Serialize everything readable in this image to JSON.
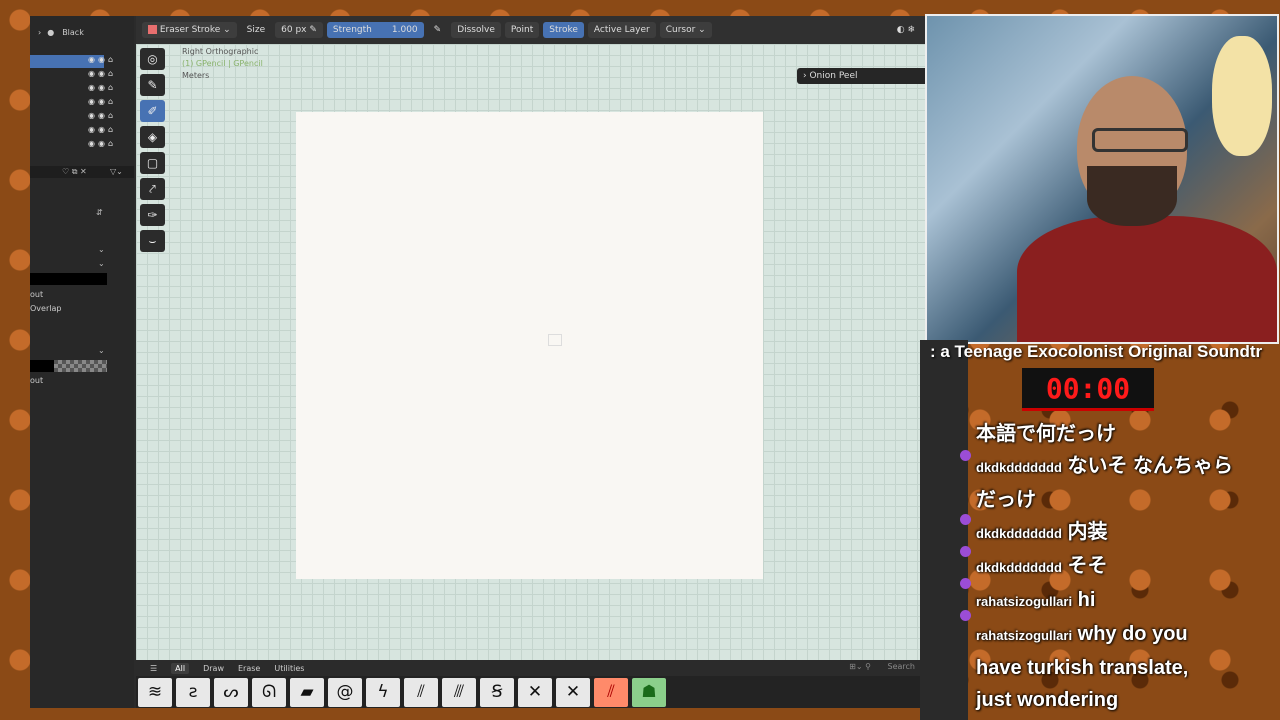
{
  "outliner": {
    "header_label": "Black",
    "rows": [
      "",
      "",
      "",
      "",
      "",
      "",
      ""
    ]
  },
  "properties": {
    "labels": [
      "out",
      "Overlap",
      "out"
    ]
  },
  "header": {
    "tool_name": "Eraser Stroke",
    "size_label": "Size",
    "size_value": "60 px",
    "strength_label": "Strength",
    "strength_value": "1.000",
    "mode_dissolve": "Dissolve",
    "mode_point": "Point",
    "mode_stroke": "Stroke",
    "active_layer": "Active Layer",
    "cursor": "Cursor"
  },
  "viewport": {
    "view_name": "Right Orthographic",
    "object_name": "(1) GPencil | GPencil",
    "units": "Meters",
    "onion_peel": "Onion Peel"
  },
  "asset_bar": {
    "tabs": [
      "All",
      "Draw",
      "Erase",
      "Utilities"
    ],
    "search_placeholder": "Search"
  },
  "stream": {
    "music_ticker": ": a Teenage Exocolonist Original Soundtr",
    "timer": "00:00",
    "chat": [
      {
        "user": "",
        "text": "本語で何だっけ"
      },
      {
        "user": "dkdkddddddd",
        "text": "ないそ なんちゃら"
      },
      {
        "user": "",
        "text": "だっけ"
      },
      {
        "user": "dkdkddddddd",
        "text": "内装"
      },
      {
        "user": "dkdkddddddd",
        "text": "そそ"
      },
      {
        "user": "rahatsizogullari",
        "text": "hi"
      },
      {
        "user": "rahatsizogullari",
        "text": "why do you"
      },
      {
        "user": "",
        "text": "have turkish translate,"
      },
      {
        "user": "",
        "text": "just wondering"
      }
    ]
  },
  "colors": {
    "accent": "#4772b3",
    "viewport_bg": "#d7e5df",
    "timer": "#ff1a1a"
  }
}
